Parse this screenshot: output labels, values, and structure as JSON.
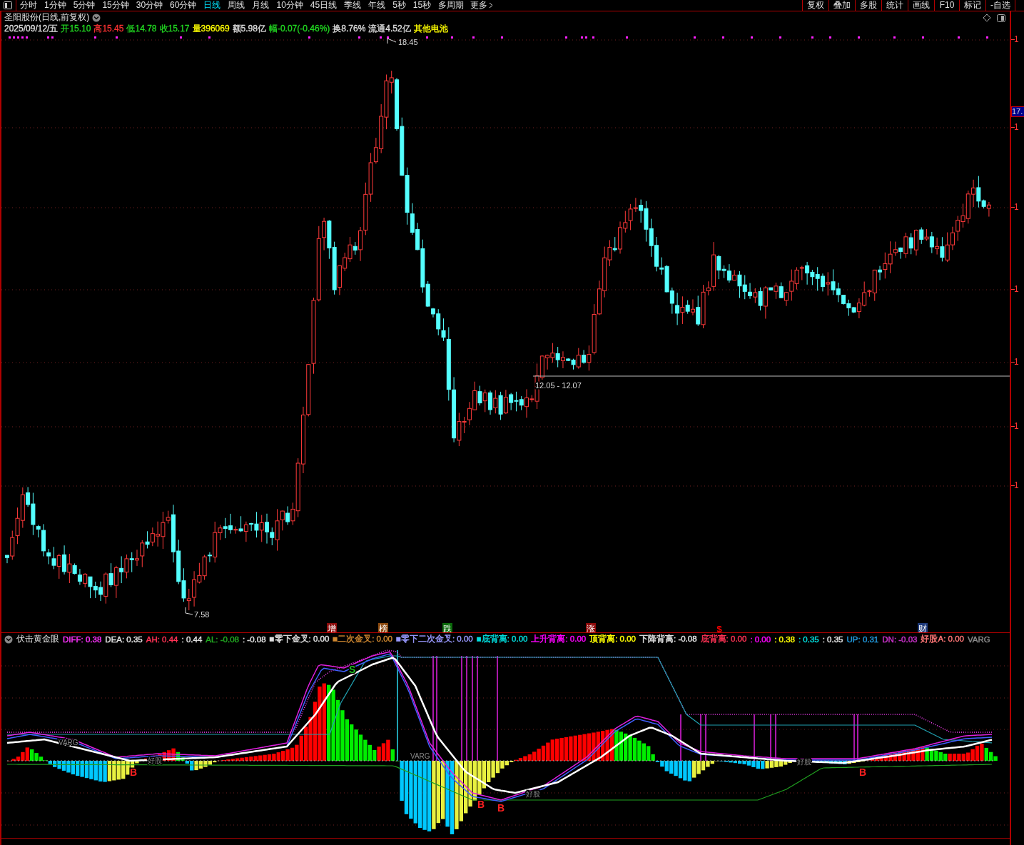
{
  "toolbar": {
    "periods": [
      {
        "label": "分时",
        "selected": false
      },
      {
        "label": "1分钟",
        "selected": false
      },
      {
        "label": "5分钟",
        "selected": false
      },
      {
        "label": "15分钟",
        "selected": false
      },
      {
        "label": "30分钟",
        "selected": false
      },
      {
        "label": "60分钟",
        "selected": false
      },
      {
        "label": "日线",
        "selected": true
      },
      {
        "label": "周线",
        "selected": false
      },
      {
        "label": "月线",
        "selected": false
      },
      {
        "label": "10分钟",
        "selected": false
      },
      {
        "label": "45日线",
        "selected": false
      },
      {
        "label": "季线",
        "selected": false
      },
      {
        "label": "年线",
        "selected": false
      },
      {
        "label": "5秒",
        "selected": false
      },
      {
        "label": "15秒",
        "selected": false
      },
      {
        "label": "多周期",
        "selected": false
      }
    ],
    "more": "更多",
    "actions": [
      "复权",
      "叠加",
      "多股",
      "统计",
      "画线",
      "F10",
      "标记",
      "-自选"
    ]
  },
  "stock": {
    "title": "圣阳股份(日线,前复权)",
    "quote": [
      {
        "text": "2025/09/12/五",
        "color": "#e0e0e0"
      },
      {
        "text": "开15.10",
        "color": "#22dd22"
      },
      {
        "text": "高15.45",
        "color": "#ff3333"
      },
      {
        "text": "低14.78",
        "color": "#22dd22"
      },
      {
        "text": "收15.17",
        "color": "#22dd22"
      },
      {
        "text": "量396069",
        "color": "#ffff00"
      },
      {
        "text": "额5.98亿",
        "color": "#e0e0e0"
      },
      {
        "text": "幅-0.07(-0.46%)",
        "color": "#22dd22"
      },
      {
        "text": "换8.76%",
        "color": "#e0e0e0"
      },
      {
        "text": "流通4.52亿",
        "color": "#e0e0e0"
      },
      {
        "text": "其他电池",
        "color": "#ffff00"
      }
    ]
  },
  "chart": {
    "high_label": "18.45",
    "low_label": "7.58",
    "range_label": "12.05 - 12.07",
    "price_tag": "17.",
    "axis_labels": [
      "1",
      "1",
      "1",
      "1",
      "1",
      "1",
      "1"
    ],
    "signals": [
      {
        "text": "增",
        "kind": "tag",
        "color": "#8b0a0a"
      },
      {
        "text": "榜",
        "kind": "tag",
        "color": "#8b4a10"
      },
      {
        "text": "跌",
        "kind": "tag",
        "color": "#0a6a0a"
      },
      {
        "text": "涨",
        "kind": "tag",
        "color": "#8b0a0a"
      },
      {
        "text": "$",
        "kind": "plain",
        "color": "#ff0000"
      },
      {
        "text": "财",
        "kind": "tag",
        "color": "#1e3a7a"
      }
    ]
  },
  "indicator": {
    "name": "伏击黄金眼",
    "values": [
      {
        "text": "DIFF: 0.38",
        "color": "#ff33ff"
      },
      {
        "text": "DEA: 0.35",
        "color": "#e0e0e0"
      },
      {
        "text": "AH: 0.44",
        "color": "#ff3355"
      },
      {
        "text": ": 0.44",
        "color": "#e0e0e0"
      },
      {
        "text": "AL: -0.08",
        "color": "#22aa22"
      },
      {
        "text": ": -0.08",
        "color": "#e0e0e0"
      },
      {
        "text": "■零下金叉: 0.00",
        "color": "#e0e0e0"
      },
      {
        "text": "■二次金叉: 0.00",
        "color": "#d08830"
      },
      {
        "text": "■零下二次金叉: 0.00",
        "color": "#9999ff"
      },
      {
        "text": "■底背离: 0.00",
        "color": "#00dddd"
      },
      {
        "text": "上升背离: 0.00",
        "color": "#ff00ff"
      },
      {
        "text": "顶背离: 0.00",
        "color": "#ffff00"
      },
      {
        "text": "下降背离: -0.08",
        "color": "#e0e0e0"
      },
      {
        "text": "底背离: 0.00",
        "color": "#ff3355"
      },
      {
        "text": ": 0.00",
        "color": "#ff00ff"
      },
      {
        "text": ": 0.38",
        "color": "#ffff00"
      },
      {
        "text": ": 0.35",
        "color": "#00dddd"
      },
      {
        "text": ": 0.35",
        "color": "#e0e0e0"
      },
      {
        "text": "UP: 0.31",
        "color": "#2299dd"
      },
      {
        "text": "DN: -0.03",
        "color": "#cc33cc"
      },
      {
        "text": "好股A: 0.00",
        "color": "#ff7777"
      },
      {
        "text": "VARG",
        "color": "#888888"
      }
    ],
    "marks": [
      {
        "text": "VARG",
        "kind": "note"
      },
      {
        "text": "B",
        "kind": "buy"
      },
      {
        "text": "好股",
        "kind": "note"
      },
      {
        "text": "S",
        "kind": "sell"
      },
      {
        "text": "VARG",
        "kind": "note"
      },
      {
        "text": "B",
        "kind": "buy"
      },
      {
        "text": "B",
        "kind": "buy"
      },
      {
        "text": "好股",
        "kind": "note"
      },
      {
        "text": "好股",
        "kind": "note"
      },
      {
        "text": "B",
        "kind": "buy"
      }
    ]
  }
}
